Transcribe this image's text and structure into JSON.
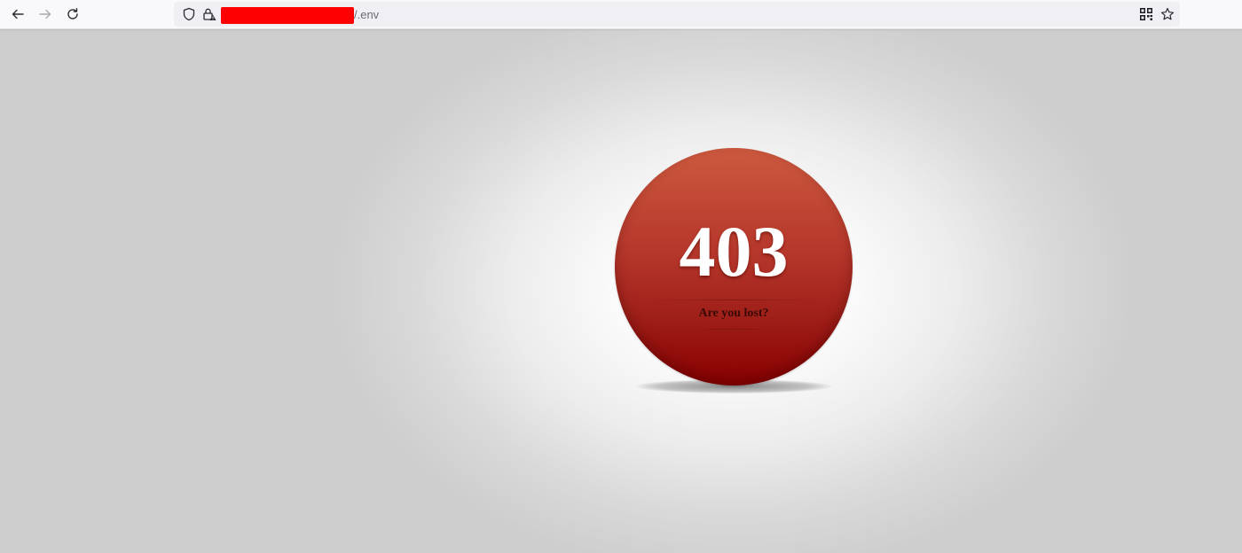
{
  "browser": {
    "url_suffix": "/.env",
    "icons": {
      "back": "back-arrow-icon",
      "forward": "forward-arrow-icon",
      "reload": "reload-icon",
      "shield": "shield-icon",
      "lock": "lock-warning-icon",
      "qr": "qr-code-icon",
      "bookmark": "star-icon"
    },
    "redaction_color": "#ff0000"
  },
  "page": {
    "error_code": "403",
    "message": "Are you lost?",
    "ball_color_top": "#cd5a3f",
    "ball_color_bottom": "#8a0000"
  }
}
